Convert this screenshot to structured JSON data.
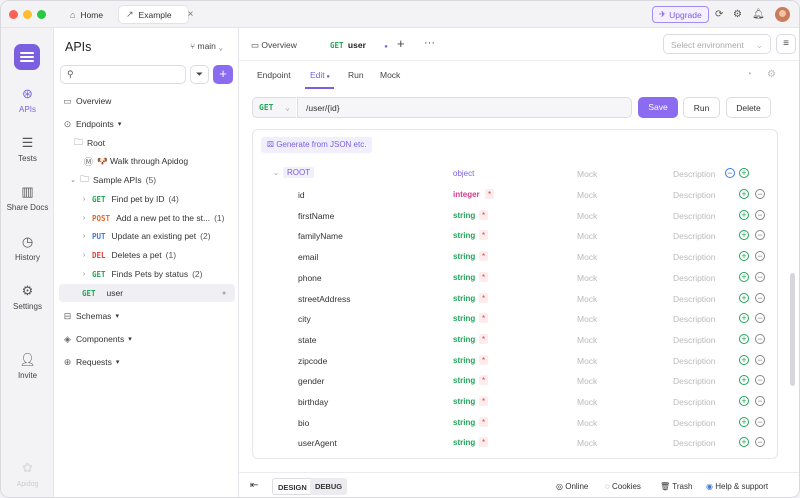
{
  "titlebar": {
    "tabs": [
      {
        "label": "Home",
        "icon": "home-icon"
      },
      {
        "label": "Example",
        "icon": "external-link-icon"
      }
    ],
    "upgrade_label": "Upgrade"
  },
  "rail": {
    "items": [
      {
        "label": "APIs",
        "icon": "api-icon"
      },
      {
        "label": "Tests",
        "icon": "tests-icon"
      },
      {
        "label": "Share Docs",
        "icon": "book-icon"
      },
      {
        "label": "History",
        "icon": "clock-icon"
      },
      {
        "label": "Settings",
        "icon": "gear-icon"
      },
      {
        "label": "Invite",
        "icon": "add-user-icon"
      }
    ],
    "footer": "Apidog"
  },
  "sidebar": {
    "title": "APIs",
    "branch": "main",
    "tree": {
      "overview": "Overview",
      "endpoints": "Endpoints",
      "root": "Root",
      "walkthrough": "🐶 Walk through Apidog",
      "sample": "Sample APIs",
      "sample_count": "(5)",
      "items": [
        {
          "method": "GET",
          "label": "Find pet by ID",
          "count": "(4)"
        },
        {
          "method": "POST",
          "label": "Add a new pet to the st...",
          "count": "(1)"
        },
        {
          "method": "PUT",
          "label": "Update an existing pet",
          "count": "(2)"
        },
        {
          "method": "DEL",
          "label": "Deletes a pet",
          "count": "(1)"
        },
        {
          "method": "GET",
          "label": "Finds Pets by status",
          "count": "(2)"
        }
      ],
      "selected": {
        "method": "GET",
        "label": "user"
      },
      "schemas": "Schemas",
      "components": "Components",
      "requests": "Requests"
    }
  },
  "main": {
    "tabs": {
      "overview": "Overview",
      "user_method": "GET",
      "user_label": "user"
    },
    "env_placeholder": "Select environment",
    "subtabs": [
      "Endpoint",
      "Edit",
      "Run",
      "Mock"
    ],
    "request": {
      "method": "GET",
      "url": "/user/{id}"
    },
    "buttons": {
      "save": "Save",
      "run": "Run",
      "delete": "Delete"
    },
    "generate": "Generate from JSON etc.",
    "schema": {
      "root": {
        "name": "ROOT",
        "type": "object",
        "mock": "Mock",
        "description": "Description"
      },
      "fields": [
        {
          "name": "id",
          "type": "integer"
        },
        {
          "name": "firstName",
          "type": "string"
        },
        {
          "name": "familyName",
          "type": "string"
        },
        {
          "name": "email",
          "type": "string"
        },
        {
          "name": "phone",
          "type": "string"
        },
        {
          "name": "streetAddress",
          "type": "string"
        },
        {
          "name": "city",
          "type": "string"
        },
        {
          "name": "state",
          "type": "string"
        },
        {
          "name": "zipcode",
          "type": "string"
        },
        {
          "name": "gender",
          "type": "string"
        },
        {
          "name": "birthday",
          "type": "string"
        },
        {
          "name": "bio",
          "type": "string"
        },
        {
          "name": "userAgent",
          "type": "string"
        }
      ],
      "required_mark": "*",
      "mock_label": "Mock",
      "desc_label": "Description"
    },
    "footer": {
      "design": "DESIGN",
      "debug": "DEBUG",
      "online": "Online",
      "cookies": "Cookies",
      "trash": "Trash",
      "help": "Help & support"
    }
  },
  "colors": {
    "accent": "#7a5fe0",
    "get": "#22a55a",
    "post": "#e06a2b",
    "put": "#3e7ae0",
    "del": "#e0433b"
  }
}
